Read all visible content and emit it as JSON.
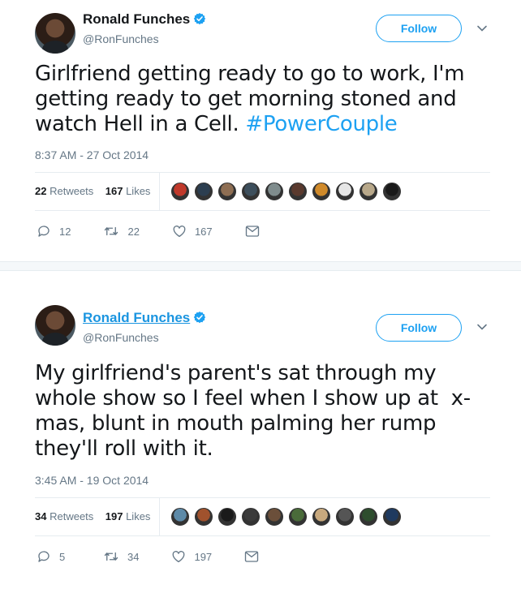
{
  "tweets": [
    {
      "name": "Ronald Funches",
      "handle": "@RonFunches",
      "follow_label": "Follow",
      "text": "Girlfriend getting ready to go to work, I'm getting ready to get morning stoned and watch Hell in a Cell. ",
      "hashtag": "#PowerCouple",
      "time": "8:37 AM - 27 Oct 2014",
      "retweets": "22",
      "retweets_label": "Retweets",
      "likes": "167",
      "likes_label": "Likes",
      "replies_count": "12",
      "retweet_count": "22",
      "like_count": "167",
      "liker_colors": [
        "#c0392b",
        "#2c3e50",
        "#8e6e53",
        "#3d4f5c",
        "#7f8c8d",
        "#5a3a2e",
        "#d08a2a",
        "#e6e6e6",
        "#b8a88a",
        "#1a1a1a"
      ]
    },
    {
      "name": "Ronald Funches",
      "handle": "@RonFunches",
      "follow_label": "Follow",
      "text": "My girlfriend's parent's sat through my whole show so I feel when I show up at  x-mas, blunt in mouth palming her rump they'll roll with it.",
      "time": "3:45 AM - 19 Oct 2014",
      "retweets": "34",
      "retweets_label": "Retweets",
      "likes": "197",
      "likes_label": "Likes",
      "replies_count": "5",
      "retweet_count": "34",
      "like_count": "197",
      "liker_colors": [
        "#5d8aa8",
        "#a0522d",
        "#1a1a1a",
        "#3b3b3b",
        "#6b4f3a",
        "#4a6b3a",
        "#c8a97e",
        "#555555",
        "#2e4d2e",
        "#1f3a5f"
      ]
    }
  ],
  "colors": {
    "accent": "#1da1f2",
    "link": "#1b95e0",
    "verified": "#1da1f2",
    "muted": "#657786"
  }
}
